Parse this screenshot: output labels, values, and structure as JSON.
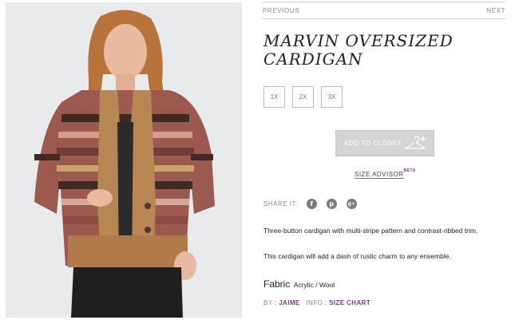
{
  "nav": {
    "previous": "PREVIOUS",
    "next": "NEXT"
  },
  "product": {
    "title_line1": "MARVIN OVERSIZED",
    "title_line2": "CARDIGAN",
    "sizes": [
      "1X",
      "2X",
      "3X"
    ],
    "add_to_closet": "ADD TO CLOSET",
    "size_advisor": "SIZE ADVISOR",
    "size_advisor_badge": "BETA",
    "share_label": "SHARE IT:",
    "share_icons": [
      "f",
      "p",
      "g+"
    ],
    "description_1": "Three-button cardigan with multi-stripe pattern and contrast-ribbed trim.",
    "description_2": "This cardigan will add a dash of rustic charm to any ensemble.",
    "fabric_label": "Fabric",
    "fabric_value": "Acrylic / Wool",
    "by_label": "BY :",
    "by_name": "JAIME",
    "info_label": "INFO :",
    "info_link": "SIZE CHART"
  },
  "colors": {
    "accent": "#7a3b8f",
    "button_gray": "#d4d4d4",
    "photo_background": "#e9eaec"
  }
}
